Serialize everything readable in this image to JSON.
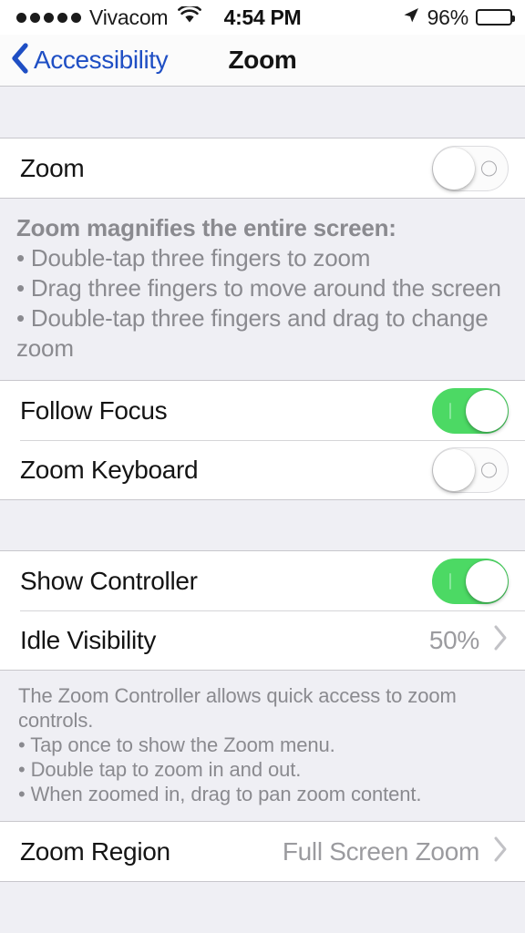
{
  "status_bar": {
    "signal_dots_filled": 5,
    "signal_dots_total": 5,
    "carrier": "Vivacom",
    "wifi_icon": "wifi-icon",
    "time": "4:54 PM",
    "location_icon": "location-arrow-icon",
    "battery_percent": "96%",
    "battery_level": 96
  },
  "nav": {
    "back_label": "Accessibility",
    "back_icon": "chevron-left-icon",
    "title": "Zoom"
  },
  "sections": {
    "zoom_toggle_row": {
      "label": "Zoom",
      "toggle_state": "off"
    },
    "zoom_footer": {
      "heading": "Zoom magnifies the entire screen:",
      "bullets": [
        "•  Double-tap three fingers to zoom",
        "•  Drag three fingers to move around the screen",
        "•  Double-tap three fingers and drag to change zoom"
      ]
    },
    "focus_group": [
      {
        "label": "Follow Focus",
        "toggle_state": "on"
      },
      {
        "label": "Zoom Keyboard",
        "toggle_state": "off"
      }
    ],
    "controller_group": [
      {
        "label": "Show Controller",
        "toggle_state": "on"
      },
      {
        "label": "Idle Visibility",
        "value": "50%",
        "accessory": "chevron-right-icon"
      }
    ],
    "controller_footer": {
      "lines": [
        "The Zoom Controller allows quick access to zoom controls.",
        "• Tap once to show the Zoom menu.",
        "• Double tap to zoom in and out.",
        "• When zoomed in, drag to pan zoom content."
      ]
    },
    "region_group": [
      {
        "label": "Zoom Region",
        "value": "Full Screen Zoom",
        "accessory": "chevron-right-icon"
      }
    ]
  },
  "colors": {
    "accent_blue": "#1f4fc4",
    "toggle_on_green": "#4cd964",
    "group_background": "#ffffff",
    "page_background": "#efeff4",
    "secondary_text": "#8a8a8f"
  }
}
